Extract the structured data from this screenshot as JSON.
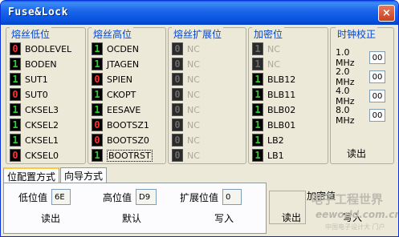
{
  "window": {
    "title": "Fuse&Lock",
    "close": "×"
  },
  "groups": [
    {
      "title": "熔丝低位",
      "items": [
        {
          "bit": "0",
          "name": "BODLEVEL",
          "enabled": true
        },
        {
          "bit": "1",
          "name": "BODEN",
          "enabled": true
        },
        {
          "bit": "1",
          "name": "SUT1",
          "enabled": true
        },
        {
          "bit": "0",
          "name": "SUT0",
          "enabled": true
        },
        {
          "bit": "1",
          "name": "CKSEL3",
          "enabled": true
        },
        {
          "bit": "1",
          "name": "CKSEL2",
          "enabled": true
        },
        {
          "bit": "1",
          "name": "CKSEL1",
          "enabled": true
        },
        {
          "bit": "0",
          "name": "CKSEL0",
          "enabled": true
        }
      ]
    },
    {
      "title": "熔丝高位",
      "items": [
        {
          "bit": "1",
          "name": "OCDEN",
          "enabled": true
        },
        {
          "bit": "1",
          "name": "JTAGEN",
          "enabled": true
        },
        {
          "bit": "0",
          "name": "SPIEN",
          "enabled": true
        },
        {
          "bit": "1",
          "name": "CKOPT",
          "enabled": true
        },
        {
          "bit": "1",
          "name": "EESAVE",
          "enabled": true
        },
        {
          "bit": "0",
          "name": "BOOTSZ1",
          "enabled": true
        },
        {
          "bit": "0",
          "name": "BOOTSZ0",
          "enabled": true
        },
        {
          "bit": "1",
          "name": "BOOTRST",
          "enabled": true,
          "focused": true
        }
      ]
    },
    {
      "title": "熔丝扩展位",
      "items": [
        {
          "bit": "0",
          "name": "NC",
          "enabled": false
        },
        {
          "bit": "0",
          "name": "NC",
          "enabled": false
        },
        {
          "bit": "0",
          "name": "NC",
          "enabled": false
        },
        {
          "bit": "0",
          "name": "NC",
          "enabled": false
        },
        {
          "bit": "0",
          "name": "NC",
          "enabled": false
        },
        {
          "bit": "0",
          "name": "NC",
          "enabled": false
        },
        {
          "bit": "0",
          "name": "NC",
          "enabled": false
        },
        {
          "bit": "0",
          "name": "NC",
          "enabled": false
        }
      ]
    },
    {
      "title": "加密位",
      "items": [
        {
          "bit": "1",
          "name": "NC",
          "enabled": false
        },
        {
          "bit": "1",
          "name": "NC",
          "enabled": false
        },
        {
          "bit": "1",
          "name": "BLB12",
          "enabled": true
        },
        {
          "bit": "1",
          "name": "BLB11",
          "enabled": true
        },
        {
          "bit": "1",
          "name": "BLB02",
          "enabled": true
        },
        {
          "bit": "1",
          "name": "BLB01",
          "enabled": true
        },
        {
          "bit": "1",
          "name": "LB2",
          "enabled": true
        },
        {
          "bit": "1",
          "name": "LB1",
          "enabled": true
        }
      ]
    }
  ],
  "clock": {
    "title": "时钟校正",
    "rows": [
      {
        "label": "1.0 MHz",
        "value": "00"
      },
      {
        "label": "2.0 MHz",
        "value": "00"
      },
      {
        "label": "4.0 MHz",
        "value": "00"
      },
      {
        "label": "8.0 MHz",
        "value": "00"
      }
    ],
    "read_label": "读出"
  },
  "tabs": [
    {
      "label": "位配置方式",
      "active": true
    },
    {
      "label": "向导方式",
      "active": false
    }
  ],
  "panel": {
    "low_label": "低位值",
    "low_value": "6E",
    "high_label": "高位值",
    "high_value": "D9",
    "ext_label": "扩展位值",
    "ext_value": "0",
    "read_label": "读出",
    "default_label": "默认",
    "write_label": "写入"
  },
  "lock_panel": {
    "label": "加密值",
    "read_label": "读出",
    "write_label": "写入"
  },
  "watermark": {
    "cn": "电子工程世界",
    "en": "eeworld.com.cn",
    "sub": "中国电子设计大 门户"
  }
}
